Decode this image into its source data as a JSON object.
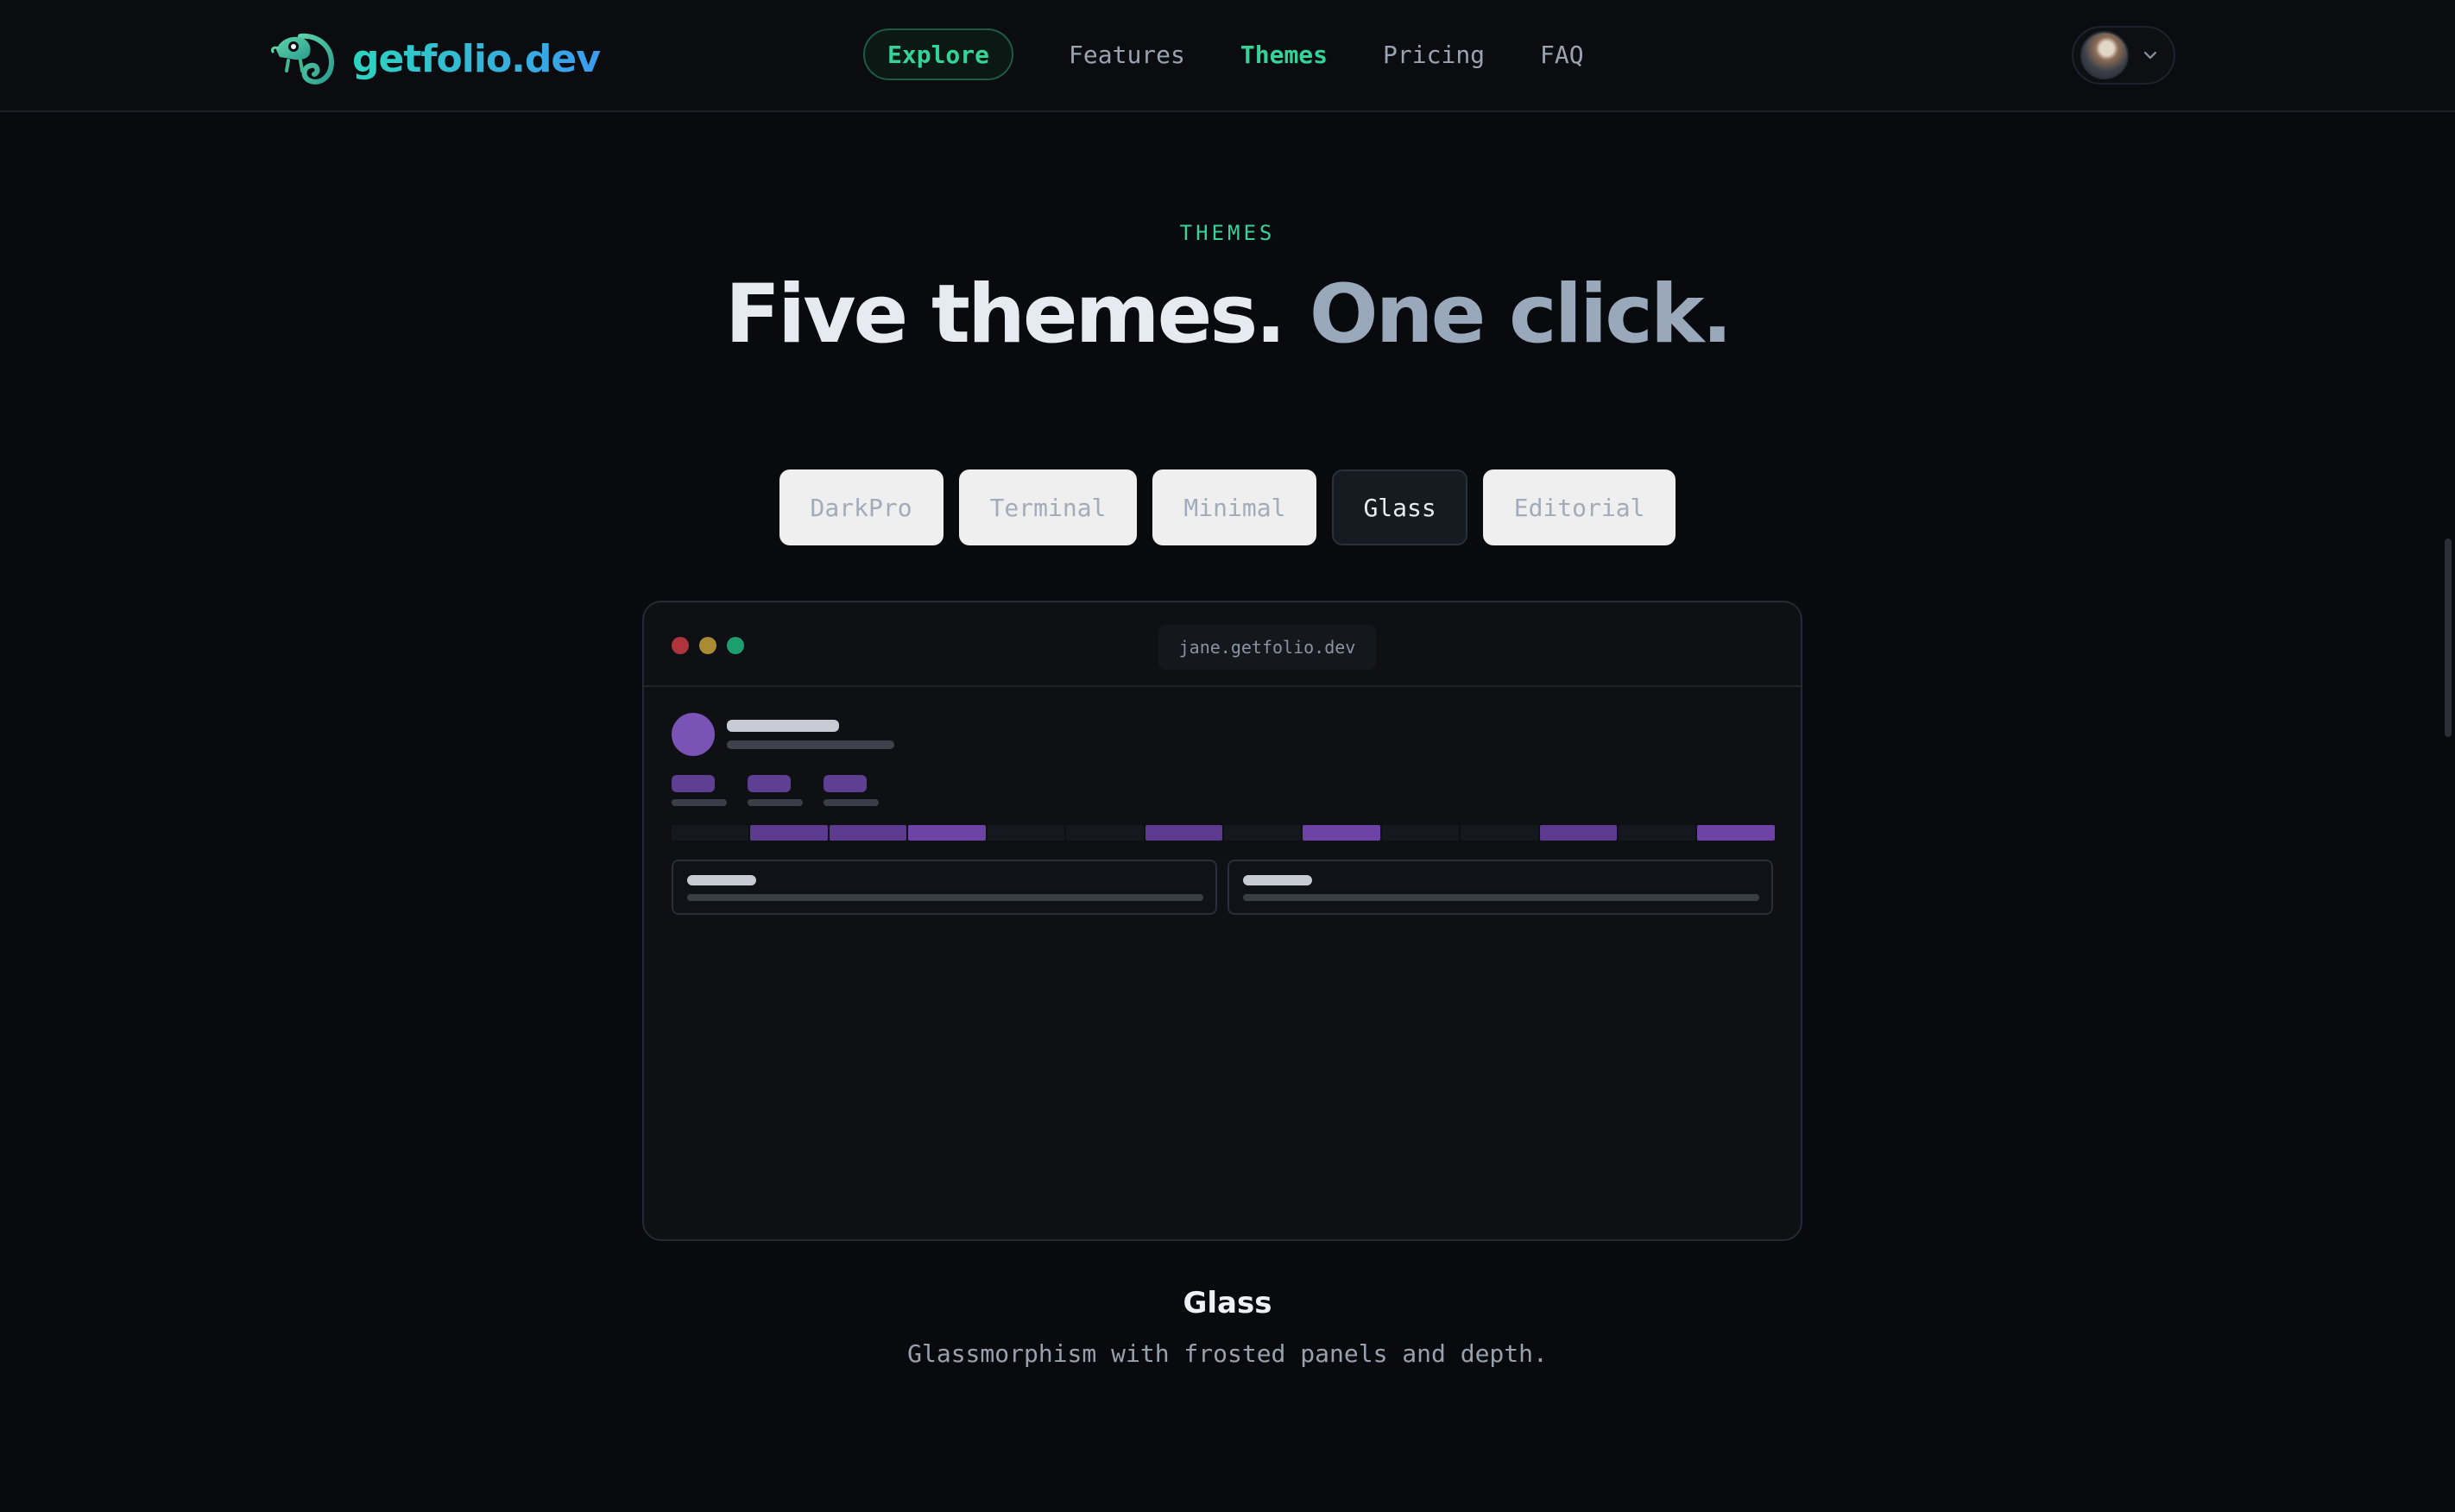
{
  "header": {
    "brand": "getfolio.dev",
    "nav": {
      "explore": "Explore",
      "features": "Features",
      "themes": "Themes",
      "pricing": "Pricing",
      "faq": "FAQ"
    },
    "active_item": "Themes"
  },
  "section": {
    "eyebrow": "THEMES",
    "headline_primary": "Five themes.",
    "headline_secondary": "One click."
  },
  "tabs": [
    "DarkPro",
    "Terminal",
    "Minimal",
    "Glass",
    "Editorial"
  ],
  "selected_tab": "Glass",
  "preview": {
    "url": "jane.getfolio.dev",
    "traffic_lights": [
      "#b0343b",
      "#a88b33",
      "#1d9e6f"
    ],
    "accent": "#7b52b5"
  },
  "caption": {
    "title": "Glass",
    "description": "Glassmorphism with frosted panels and depth."
  },
  "colors": {
    "background": "#090a0d",
    "accent_green": "#34d399",
    "brand_gradient": [
      "#2dd4bf",
      "#3b9bf0"
    ]
  },
  "icons": {
    "logo": "chameleon-logo-icon",
    "account_menu": "chevron-down-icon"
  }
}
